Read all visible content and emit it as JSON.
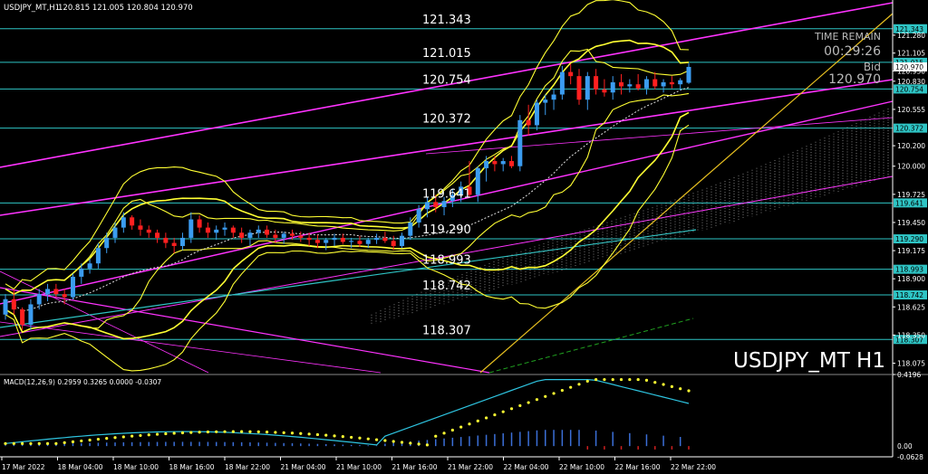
{
  "header": {
    "symbol_info": "USDJPY_MT,H1",
    "ohlc": "120.815 121.005 120.804 120.970",
    "time_remain_label": "TIME REMAIN",
    "time_remain_value": "00:29:26",
    "bid_label": "Bid",
    "bid_value": "120.970",
    "watermark": "USDJPY_MT H1"
  },
  "colors": {
    "background": "#000000",
    "bull": "#3b9cf0",
    "bear": "#ff2020",
    "level": "#2ec4c4",
    "bollinger": "#ffff33",
    "channel": "#ff33ff",
    "ichimoku": "#cfcfcf",
    "macd_hist_pos": "#3b6fd8",
    "macd_hist_neg": "#d02020",
    "macd_signal": "#2ec4e0",
    "macd_dots": "#ffff33",
    "axis_text": "#ffffff"
  },
  "chart_data": {
    "type": "line",
    "title": "USDJPY_MT H1",
    "ylim": [
      118.0,
      121.5
    ],
    "y_ticks": [
      121.28,
      121.105,
      120.93,
      120.83,
      120.555,
      120.2,
      120.0,
      119.725,
      119.45,
      119.175,
      118.9,
      118.625,
      118.35,
      118.075
    ],
    "y_tick_labels": [
      "121.280",
      "121.105",
      "120.930",
      "120.830",
      "120.555",
      "120.200",
      "120.000",
      "119.725",
      "119.450",
      "119.175",
      "118.900",
      "118.625",
      "118.350",
      "118.075"
    ],
    "x_tick_labels": [
      "17 Mar 2022",
      "18 Mar 04:00",
      "18 Mar 10:00",
      "18 Mar 16:00",
      "18 Mar 22:00",
      "21 Mar 04:00",
      "21 Mar 10:00",
      "21 Mar 16:00",
      "21 Mar 22:00",
      "22 Mar 04:00",
      "22 Mar 10:00",
      "22 Mar 16:00",
      "22 Mar 22:00"
    ],
    "levels": [
      121.343,
      121.015,
      120.754,
      120.372,
      119.641,
      119.29,
      118.993,
      118.742,
      118.307
    ],
    "level_labels": [
      "121.343",
      "121.015",
      "120.754",
      "120.372",
      "119.641",
      "119.290",
      "118.993",
      "118.742",
      "118.307"
    ],
    "candles": [
      [
        118.55,
        118.75,
        118.5,
        118.7
      ],
      [
        118.7,
        118.8,
        118.55,
        118.6
      ],
      [
        118.6,
        118.62,
        118.4,
        118.45
      ],
      [
        118.45,
        118.7,
        118.4,
        118.65
      ],
      [
        118.65,
        118.8,
        118.6,
        118.75
      ],
      [
        118.75,
        118.85,
        118.68,
        118.8
      ],
      [
        118.8,
        118.85,
        118.72,
        118.75
      ],
      [
        118.75,
        118.8,
        118.65,
        118.72
      ],
      [
        118.72,
        118.95,
        118.7,
        118.92
      ],
      [
        118.92,
        119.05,
        118.85,
        119.0
      ],
      [
        119.0,
        119.1,
        118.95,
        119.05
      ],
      [
        119.05,
        119.25,
        119.0,
        119.2
      ],
      [
        119.2,
        119.35,
        119.15,
        119.3
      ],
      [
        119.3,
        119.45,
        119.25,
        119.4
      ],
      [
        119.4,
        119.55,
        119.35,
        119.5
      ],
      [
        119.5,
        119.52,
        119.38,
        119.42
      ],
      [
        119.42,
        119.48,
        119.32,
        119.38
      ],
      [
        119.38,
        119.42,
        119.3,
        119.35
      ],
      [
        119.35,
        119.38,
        119.25,
        119.3
      ],
      [
        119.3,
        119.35,
        119.2,
        119.25
      ],
      [
        119.25,
        119.3,
        119.15,
        119.22
      ],
      [
        119.22,
        119.35,
        119.18,
        119.3
      ],
      [
        119.3,
        119.55,
        119.25,
        119.48
      ],
      [
        119.48,
        119.52,
        119.35,
        119.4
      ],
      [
        119.4,
        119.45,
        119.3,
        119.35
      ],
      [
        119.35,
        119.42,
        119.28,
        119.38
      ],
      [
        119.38,
        119.45,
        119.32,
        119.4
      ],
      [
        119.4,
        119.42,
        119.3,
        119.35
      ],
      [
        119.35,
        119.4,
        119.25,
        119.3
      ],
      [
        119.3,
        119.38,
        119.22,
        119.35
      ],
      [
        119.35,
        119.42,
        119.3,
        119.38
      ],
      [
        119.38,
        119.42,
        119.3,
        119.33
      ],
      [
        119.33,
        119.38,
        119.25,
        119.3
      ],
      [
        119.3,
        119.36,
        119.24,
        119.34
      ],
      [
        119.34,
        119.38,
        119.28,
        119.32
      ],
      [
        119.32,
        119.36,
        119.26,
        119.3
      ],
      [
        119.3,
        119.35,
        119.22,
        119.28
      ],
      [
        119.28,
        119.33,
        119.2,
        119.25
      ],
      [
        119.25,
        119.3,
        119.18,
        119.28
      ],
      [
        119.28,
        119.34,
        119.22,
        119.3
      ],
      [
        119.3,
        119.34,
        119.24,
        119.26
      ],
      [
        119.26,
        119.3,
        119.2,
        119.27
      ],
      [
        119.27,
        119.32,
        119.21,
        119.24
      ],
      [
        119.24,
        119.3,
        119.2,
        119.28
      ],
      [
        119.28,
        119.34,
        119.24,
        119.3
      ],
      [
        119.3,
        119.36,
        119.25,
        119.27
      ],
      [
        119.27,
        119.32,
        119.18,
        119.22
      ],
      [
        119.22,
        119.35,
        119.2,
        119.32
      ],
      [
        119.32,
        119.5,
        119.28,
        119.45
      ],
      [
        119.45,
        119.62,
        119.4,
        119.58
      ],
      [
        119.58,
        119.7,
        119.5,
        119.65
      ],
      [
        119.65,
        119.72,
        119.55,
        119.6
      ],
      [
        119.6,
        119.7,
        119.52,
        119.66
      ],
      [
        119.66,
        119.78,
        119.6,
        119.72
      ],
      [
        119.72,
        119.85,
        119.65,
        119.8
      ],
      [
        119.8,
        120.05,
        119.7,
        119.72
      ],
      [
        119.72,
        120.0,
        119.65,
        119.98
      ],
      [
        119.98,
        120.1,
        119.85,
        120.05
      ],
      [
        120.05,
        120.1,
        119.95,
        120.02
      ],
      [
        120.02,
        120.08,
        119.95,
        120.05
      ],
      [
        120.05,
        120.1,
        119.98,
        120.0
      ],
      [
        120.0,
        120.5,
        119.95,
        120.45
      ],
      [
        120.45,
        120.6,
        120.3,
        120.4
      ],
      [
        120.4,
        120.65,
        120.35,
        120.62
      ],
      [
        120.62,
        120.7,
        120.5,
        120.65
      ],
      [
        120.65,
        120.75,
        120.55,
        120.7
      ],
      [
        120.7,
        120.98,
        120.65,
        120.92
      ],
      [
        120.92,
        121.0,
        120.8,
        120.88
      ],
      [
        120.88,
        120.95,
        120.6,
        120.65
      ],
      [
        120.65,
        120.92,
        120.55,
        120.88
      ],
      [
        120.88,
        120.95,
        120.7,
        120.75
      ],
      [
        120.75,
        120.85,
        120.68,
        120.72
      ],
      [
        120.72,
        120.88,
        120.65,
        120.82
      ],
      [
        120.82,
        120.9,
        120.7,
        120.78
      ],
      [
        120.78,
        120.85,
        120.72,
        120.8
      ],
      [
        120.8,
        120.9,
        120.74,
        120.76
      ],
      [
        120.76,
        120.88,
        120.7,
        120.85
      ],
      [
        120.85,
        120.92,
        120.75,
        120.78
      ],
      [
        120.78,
        120.85,
        120.72,
        120.82
      ],
      [
        120.82,
        120.88,
        120.76,
        120.8
      ],
      [
        120.8,
        120.86,
        120.74,
        120.84
      ],
      [
        120.815,
        121.005,
        120.804,
        120.97
      ]
    ],
    "macd": {
      "label": "MACD(12,26,9) 0.2959 0.3265 0.0000 -0.0307",
      "ylim": [
        -0.0628,
        0.4196
      ],
      "y_tick_labels": [
        "0.4196",
        "0.00",
        "-0.0628"
      ]
    }
  }
}
